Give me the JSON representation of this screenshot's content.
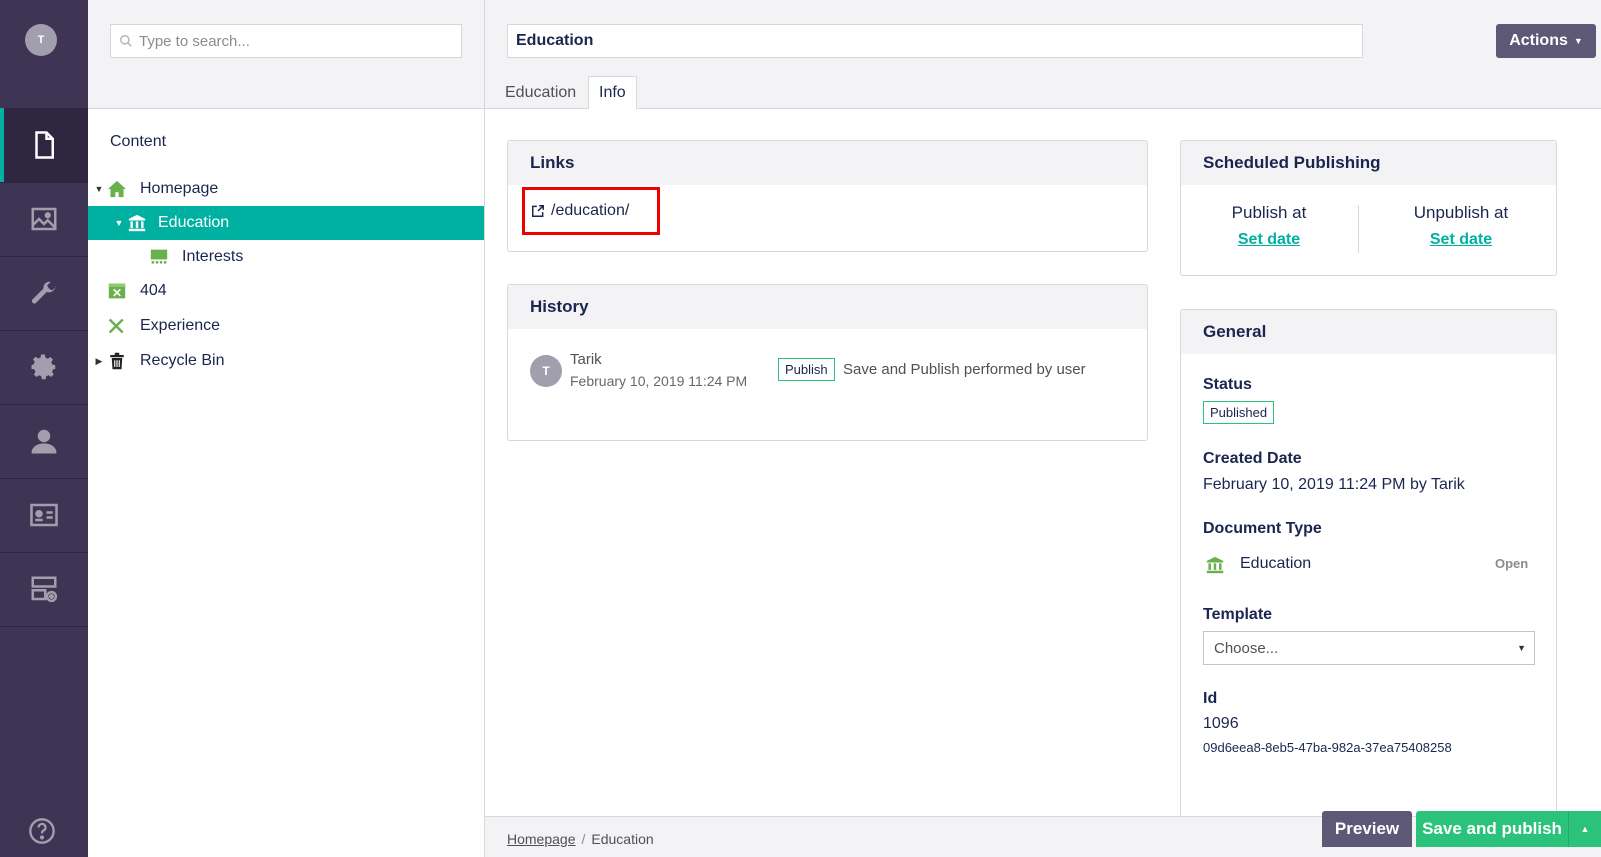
{
  "user": {
    "initial": "T"
  },
  "search": {
    "placeholder": "Type to search..."
  },
  "tree": {
    "title": "Content",
    "items": [
      {
        "label": "Homepage"
      },
      {
        "label": "Education"
      },
      {
        "label": "Interests"
      },
      {
        "label": "404"
      },
      {
        "label": "Experience"
      },
      {
        "label": "Recycle Bin"
      }
    ]
  },
  "editor": {
    "name_value": "Education",
    "actions_label": "Actions",
    "tabs": [
      {
        "label": "Education"
      },
      {
        "label": "Info"
      }
    ]
  },
  "links": {
    "title": "Links",
    "url": "/education/"
  },
  "history": {
    "title": "History",
    "entry": {
      "initial": "T",
      "user": "Tarik",
      "date": "February 10, 2019 11:24 PM",
      "badge": "Publish",
      "text": "Save and Publish performed by user"
    }
  },
  "scheduled": {
    "title": "Scheduled Publishing",
    "publish_label": "Publish at",
    "unpublish_label": "Unpublish at",
    "set_date": "Set date"
  },
  "general": {
    "title": "General",
    "status_label": "Status",
    "status_value": "Published",
    "created_label": "Created Date",
    "created_value": "February 10, 2019 11:24 PM by Tarik",
    "doctype_label": "Document Type",
    "doctype_value": "Education",
    "open_label": "Open",
    "template_label": "Template",
    "template_value": "Choose...",
    "id_label": "Id",
    "id_value": "1096",
    "guid": "09d6eea8-8eb5-47ba-982a-37ea75408258"
  },
  "footer": {
    "crumb_home": "Homepage",
    "crumb_sep": "/",
    "crumb_current": "Education",
    "preview_label": "Preview",
    "save_label": "Save and publish"
  },
  "colors": {
    "accent": "#00b0a0",
    "nav": "#3e3453",
    "success": "#2bc37c",
    "button": "#5d5876"
  }
}
